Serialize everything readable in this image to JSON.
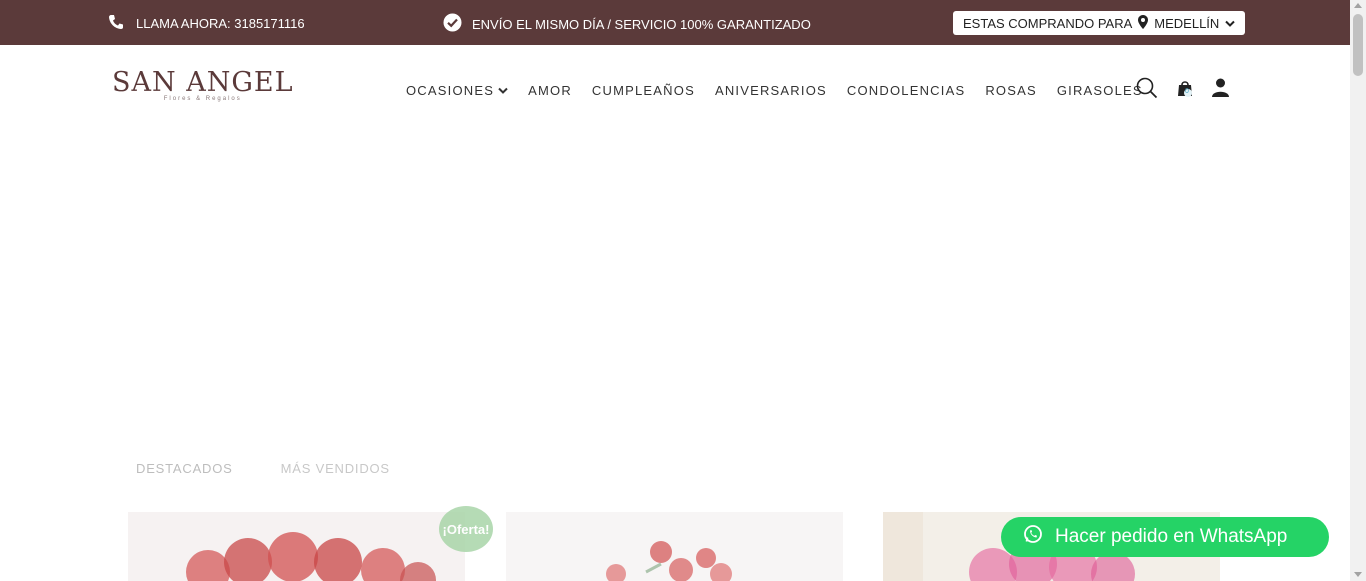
{
  "topbar": {
    "phone_text": "LLAMA AHORA: 3185171116",
    "shipping_text": "ENVÍO EL MISMO DÍA / SERVICIO 100% GARANTIZADO",
    "location_prefix": "ESTAS COMPRANDO PARA",
    "city": "MEDELLÍN",
    "bg_color": "#5b3a3a"
  },
  "header": {
    "logo_main": "SAN ANGEL",
    "logo_sub": "Flores & Regalos",
    "nav": [
      {
        "label": "OCASIONES",
        "has_dropdown": true
      },
      {
        "label": "AMOR"
      },
      {
        "label": "CUMPLEAÑOS"
      },
      {
        "label": "ANIVERSARIOS"
      },
      {
        "label": "CONDOLENCIAS"
      },
      {
        "label": "ROSAS"
      },
      {
        "label": "GIRASOLES"
      }
    ],
    "cart_count": "0",
    "icons": [
      "search-icon",
      "cart-icon",
      "user-icon"
    ]
  },
  "tabs": [
    {
      "label": "DESTACADOS",
      "active": true
    },
    {
      "label": "MÁS VENDIDOS",
      "active": false
    }
  ],
  "products": {
    "badge": "¡Oferta!"
  },
  "whatsapp": {
    "label": "Hacer pedido en WhatsApp",
    "color": "#25d366"
  }
}
